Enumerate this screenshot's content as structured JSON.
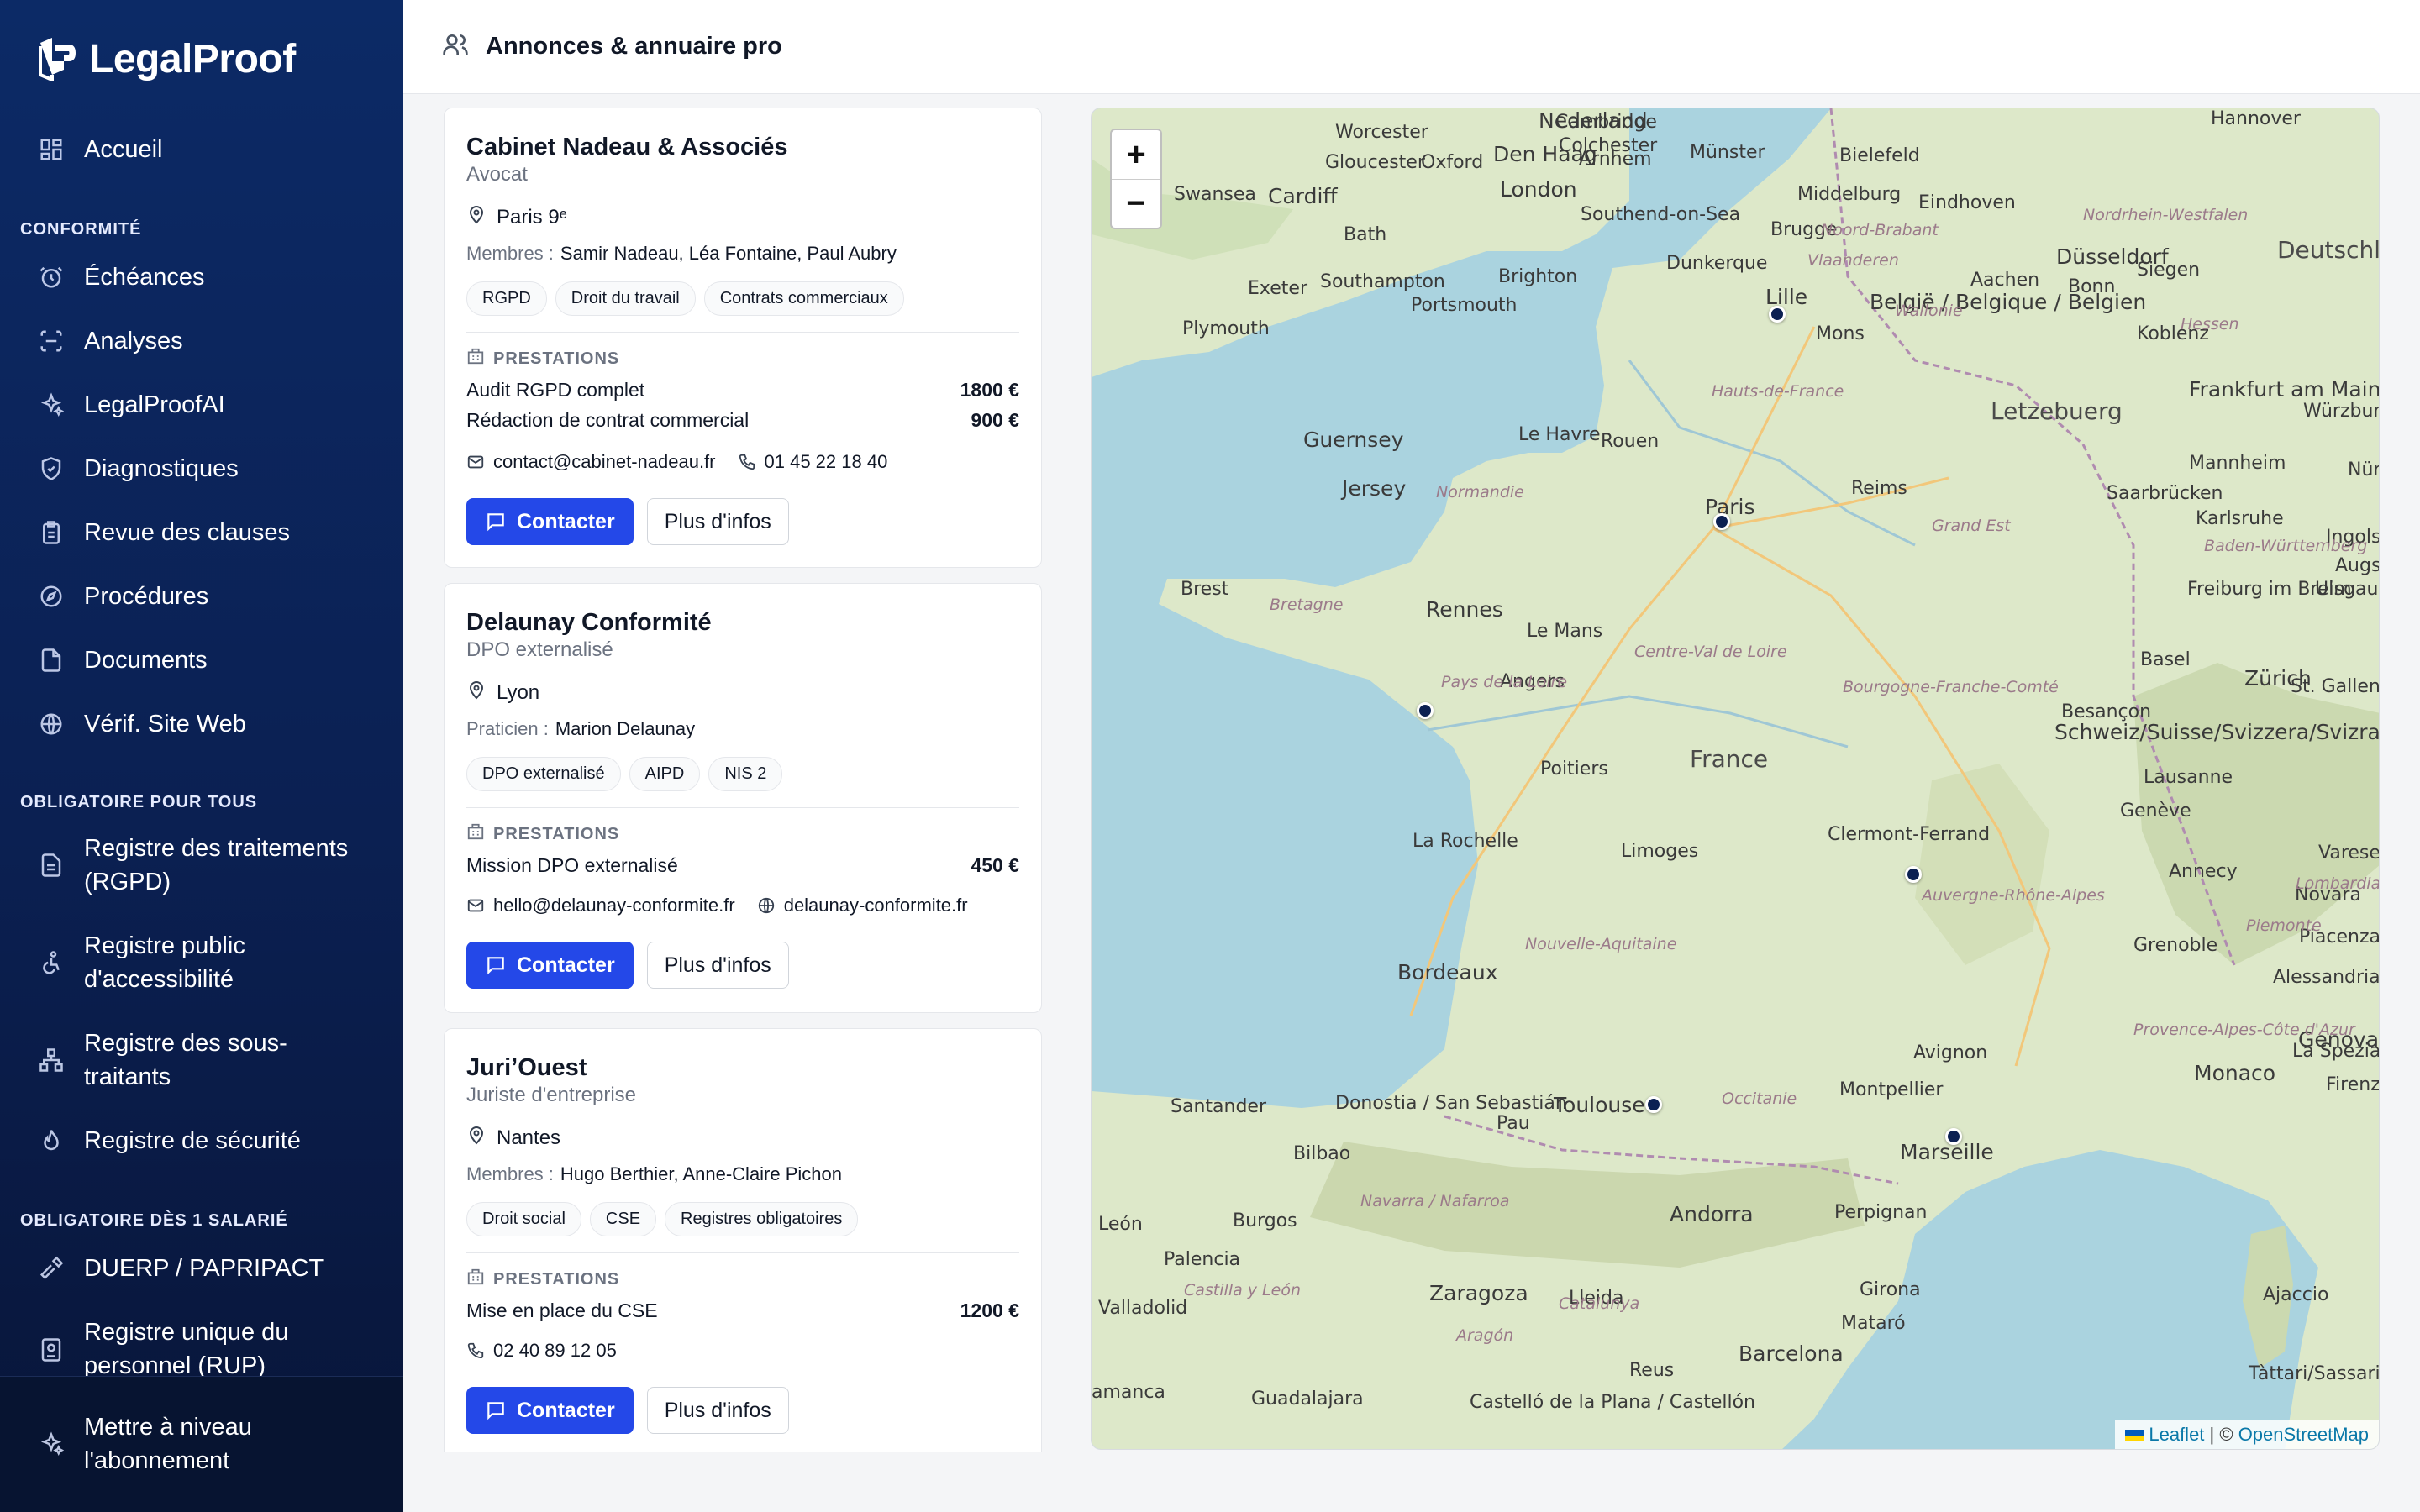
{
  "app": {
    "name": "LegalProof"
  },
  "sidebar": {
    "home": {
      "label": "Accueil",
      "icon": "grid-icon"
    },
    "sections": [
      {
        "label": "CONFORMITÉ"
      },
      {
        "label": "OBLIGATOIRE POUR TOUS"
      },
      {
        "label": "OBLIGATOIRE DÈS 1 SALARIÉ"
      }
    ],
    "items": [
      {
        "label": "Échéances",
        "icon": "alarm-icon"
      },
      {
        "label": "Analyses",
        "icon": "scan-icon"
      },
      {
        "label": "LegalProofAI",
        "icon": "sparkles-icon"
      },
      {
        "label": "Diagnostiques",
        "icon": "shield-icon"
      },
      {
        "label": "Revue des clauses",
        "icon": "clipboard-icon"
      },
      {
        "label": "Procédures",
        "icon": "compass-icon"
      },
      {
        "label": "Documents",
        "icon": "file-icon"
      },
      {
        "label": "Vérif. Site Web",
        "icon": "globe-icon"
      },
      {
        "label": "Registre des traitements (RGPD)",
        "icon": "file-list-icon"
      },
      {
        "label": "Registre public d'accessibilité",
        "icon": "accessibility-icon"
      },
      {
        "label": "Registre des sous-traitants",
        "icon": "network-icon"
      },
      {
        "label": "Registre de sécurité",
        "icon": "flame-icon"
      },
      {
        "label": "DUERP / PAPRIPACT",
        "icon": "hammer-icon"
      },
      {
        "label": "Registre unique du personnel (RUP)",
        "icon": "id-card-icon"
      }
    ],
    "upgrade": {
      "label": "Mettre à niveau l'abonnement",
      "icon": "sparkles-icon"
    }
  },
  "header": {
    "title": "Annonces & annuaire pro",
    "icon": "users-icon"
  },
  "listings": [
    {
      "name": "Cabinet Nadeau & Associés",
      "type": "Avocat",
      "city": "Paris 9ᵉ",
      "members_label": "Membres :",
      "members": "Samir Nadeau, Léa Fontaine, Paul Aubry",
      "tags": [
        "RGPD",
        "Droit du travail",
        "Contrats commerciaux"
      ],
      "prestations_label": "PRESTATIONS",
      "prestations": [
        {
          "name": "Audit RGPD complet",
          "price": "1800 €"
        },
        {
          "name": "Rédaction de contrat commercial",
          "price": "900 €"
        }
      ],
      "email": "contact@cabinet-nadeau.fr",
      "phone": "01 45 22 18 40",
      "contact_label": "Contacter",
      "more_label": "Plus d'infos"
    },
    {
      "name": "Delaunay Conformité",
      "type": "DPO externalisé",
      "city": "Lyon",
      "members_label": "Praticien :",
      "members": "Marion Delaunay",
      "tags": [
        "DPO externalisé",
        "AIPD",
        "NIS 2"
      ],
      "prestations_label": "PRESTATIONS",
      "prestations": [
        {
          "name": "Mission DPO externalisé",
          "price": "450 €"
        }
      ],
      "email": "hello@delaunay-conformite.fr",
      "website": "delaunay-conformite.fr",
      "contact_label": "Contacter",
      "more_label": "Plus d'infos"
    },
    {
      "name": "Juri’Ouest",
      "type": "Juriste d'entreprise",
      "city": "Nantes",
      "members_label": "Membres :",
      "members": "Hugo Berthier, Anne-Claire Pichon",
      "tags": [
        "Droit social",
        "CSE",
        "Registres obligatoires"
      ],
      "prestations_label": "PRESTATIONS",
      "prestations": [
        {
          "name": "Mise en place du CSE",
          "price": "1200 €"
        }
      ],
      "phone": "02 40 89 12 05",
      "contact_label": "Contacter",
      "more_label": "Plus d'infos"
    }
  ],
  "map": {
    "zoom_in": "+",
    "zoom_out": "−",
    "attribution_leaflet": "Leaflet",
    "attribution_sep": " | © ",
    "attribution_osm": "OpenStreetMap",
    "labels": [
      "Nederland",
      "Hannover",
      "Den Haag",
      "Arnhem",
      "Münster",
      "Bielefeld",
      "Cambridge",
      "Colchester",
      "Worcester",
      "Gloucester",
      "Oxford",
      "London",
      "Swansea",
      "Cardiff",
      "Bath",
      "Southend-on-Sea",
      "Middelburg",
      "Eindhoven",
      "Brugge",
      "Düsseldorf",
      "Exeter",
      "Southampton",
      "Brighton",
      "Dunkerque",
      "Portsmouth",
      "Plymouth",
      "Lille",
      "Mons",
      "België / Belgique / Belgien",
      "Aachen",
      "Bonn",
      "Siegen",
      "Koblenz",
      "Frankfurt am Main",
      "Würzbur",
      "Letzebuerg",
      "Guernsey",
      "Jersey",
      "Le Havre",
      "Rouen",
      "Paris",
      "Reims",
      "Saarbrücken",
      "Mannheim",
      "Karlsruhe",
      "Brest",
      "Rennes",
      "Le Mans",
      "Freiburg im Breisgau",
      "Ulm",
      "Angers",
      "Basel",
      "Zürich",
      "St. Gallen",
      "Besançon",
      "France",
      "Poitiers",
      "Schweiz/Suisse/Svizzera/Svizra",
      "Lausanne",
      "Genève",
      "La Rochelle",
      "Limoges",
      "Clermont-Ferrand",
      "Annecy",
      "Varese",
      "Novara",
      "Piacenza",
      "Grenoble",
      "Alessandria",
      "Bordeaux",
      "Genova",
      "Avignon",
      "Monaco",
      "La Spezia",
      "Santander",
      "Donostia / San Sebastián",
      "Pau",
      "Toulouse",
      "Montpellier",
      "Bilbao",
      "Marseille",
      "Burgos",
      "Andorra",
      "Perpignan",
      "León",
      "Palencia",
      "Valladolid",
      "Zaragoza",
      "Lleida",
      "Girona",
      "Mataró",
      "Barcelona",
      "Ajaccio",
      "Reus",
      "Guadalajara",
      "Castelló de la Plana / Castellón",
      "Tàttari/Sassari",
      "Deutschl",
      "Ingols",
      "Augs",
      "Firenz",
      "Nür",
      "amanca"
    ],
    "region_labels": [
      "Noord-Brabant",
      "Nordrhein-Westfalen",
      "Vlaanderen",
      "Wallonie",
      "Hessen",
      "Hauts-de-France",
      "Grand Est",
      "Normandie",
      "Baden-Württemberg",
      "Bretagne",
      "Centre-Val de Loire",
      "Pays de la Loire",
      "Bourgogne-Franche-Comté",
      "Auvergne-Rhône-Alpes",
      "Nouvelle-Aquitaine",
      "Lombardia",
      "Piemonte",
      "Provence-Alpes-Côte d'Azur",
      "Occitanie",
      "Navarra / Nafarroa",
      "Castilla y León",
      "Catalunya",
      "Aragón"
    ]
  }
}
